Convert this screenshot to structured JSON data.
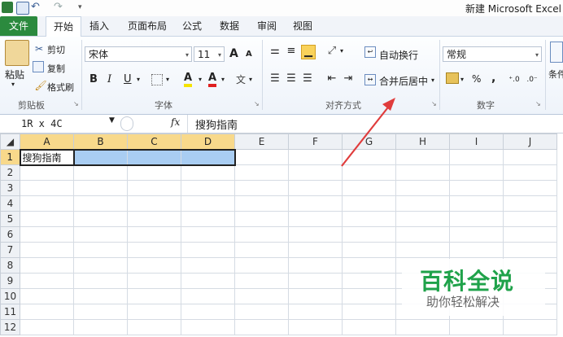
{
  "window": {
    "title": "新建 Microsoft Excel"
  },
  "tabs": [
    "文件",
    "开始",
    "插入",
    "页面布局",
    "公式",
    "数据",
    "审阅",
    "视图"
  ],
  "clipboard": {
    "paste": "粘贴",
    "cut": "剪切",
    "copy": "复制",
    "format_painter": "格式刷",
    "label": "剪贴板"
  },
  "font": {
    "name": "宋体",
    "size": "11",
    "bold": "B",
    "italic": "I",
    "underline": "U",
    "label": "字体",
    "grow": "A",
    "shrink": "A",
    "font_color_letter": "A",
    "highlight_letter": "A",
    "phonetic": "文"
  },
  "alignment": {
    "wrap": "自动换行",
    "merge": "合并后居中",
    "label": "对齐方式"
  },
  "number": {
    "format": "常规",
    "percent": "%",
    "comma": ",",
    "label": "数字"
  },
  "styles": {
    "partial_label": "条件"
  },
  "formula_bar": {
    "name_box": "1R x 4C",
    "fx": "fx",
    "content": "搜狗指南"
  },
  "sheet": {
    "columns": [
      "A",
      "B",
      "C",
      "D",
      "E",
      "F",
      "G",
      "H",
      "I",
      "J"
    ],
    "rows": [
      "1",
      "2",
      "3",
      "4",
      "5",
      "6",
      "7",
      "8",
      "9",
      "10",
      "11",
      "12"
    ],
    "cells": {
      "A1": "搜狗指南"
    }
  },
  "watermark": {
    "title": "百科全说",
    "subtitle": "助你轻松解决"
  },
  "colors": {
    "file_tab": "#2b8a3e",
    "selection": "#a9cdf2",
    "header_selected": "#f8d98b",
    "arrow": "#e03c3c",
    "watermark": "#1fa24a"
  }
}
